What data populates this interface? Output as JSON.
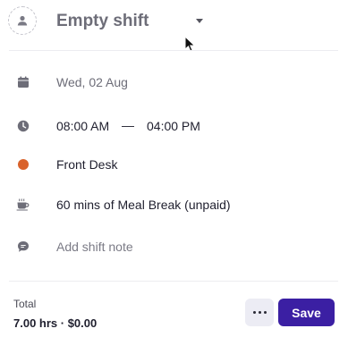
{
  "header": {
    "title": "Empty shift",
    "avatar_icon": "person-icon",
    "dropdown_icon": "caret-down-icon"
  },
  "details": {
    "date": {
      "icon": "calendar-icon",
      "text": "Wed, 02 Aug"
    },
    "time": {
      "icon": "clock-icon",
      "start": "08:00 AM",
      "separator": "—",
      "end": "04:00 PM"
    },
    "position": {
      "icon": "color-dot",
      "text": "Front Desk",
      "color": "#d9622b"
    },
    "break": {
      "icon": "coffee-cup-icon",
      "text": "60 mins of Meal Break (unpaid)"
    },
    "note": {
      "icon": "comment-icon",
      "placeholder": "Add shift note"
    }
  },
  "footer": {
    "total_label": "Total",
    "total_value": "7.00 hrs · $0.00",
    "more_icon": "more-horizontal-icon",
    "save_label": "Save"
  },
  "colors": {
    "accent": "#3b1fa3",
    "position_dot": "#d9622b",
    "icon_gray": "#6d6d78"
  }
}
